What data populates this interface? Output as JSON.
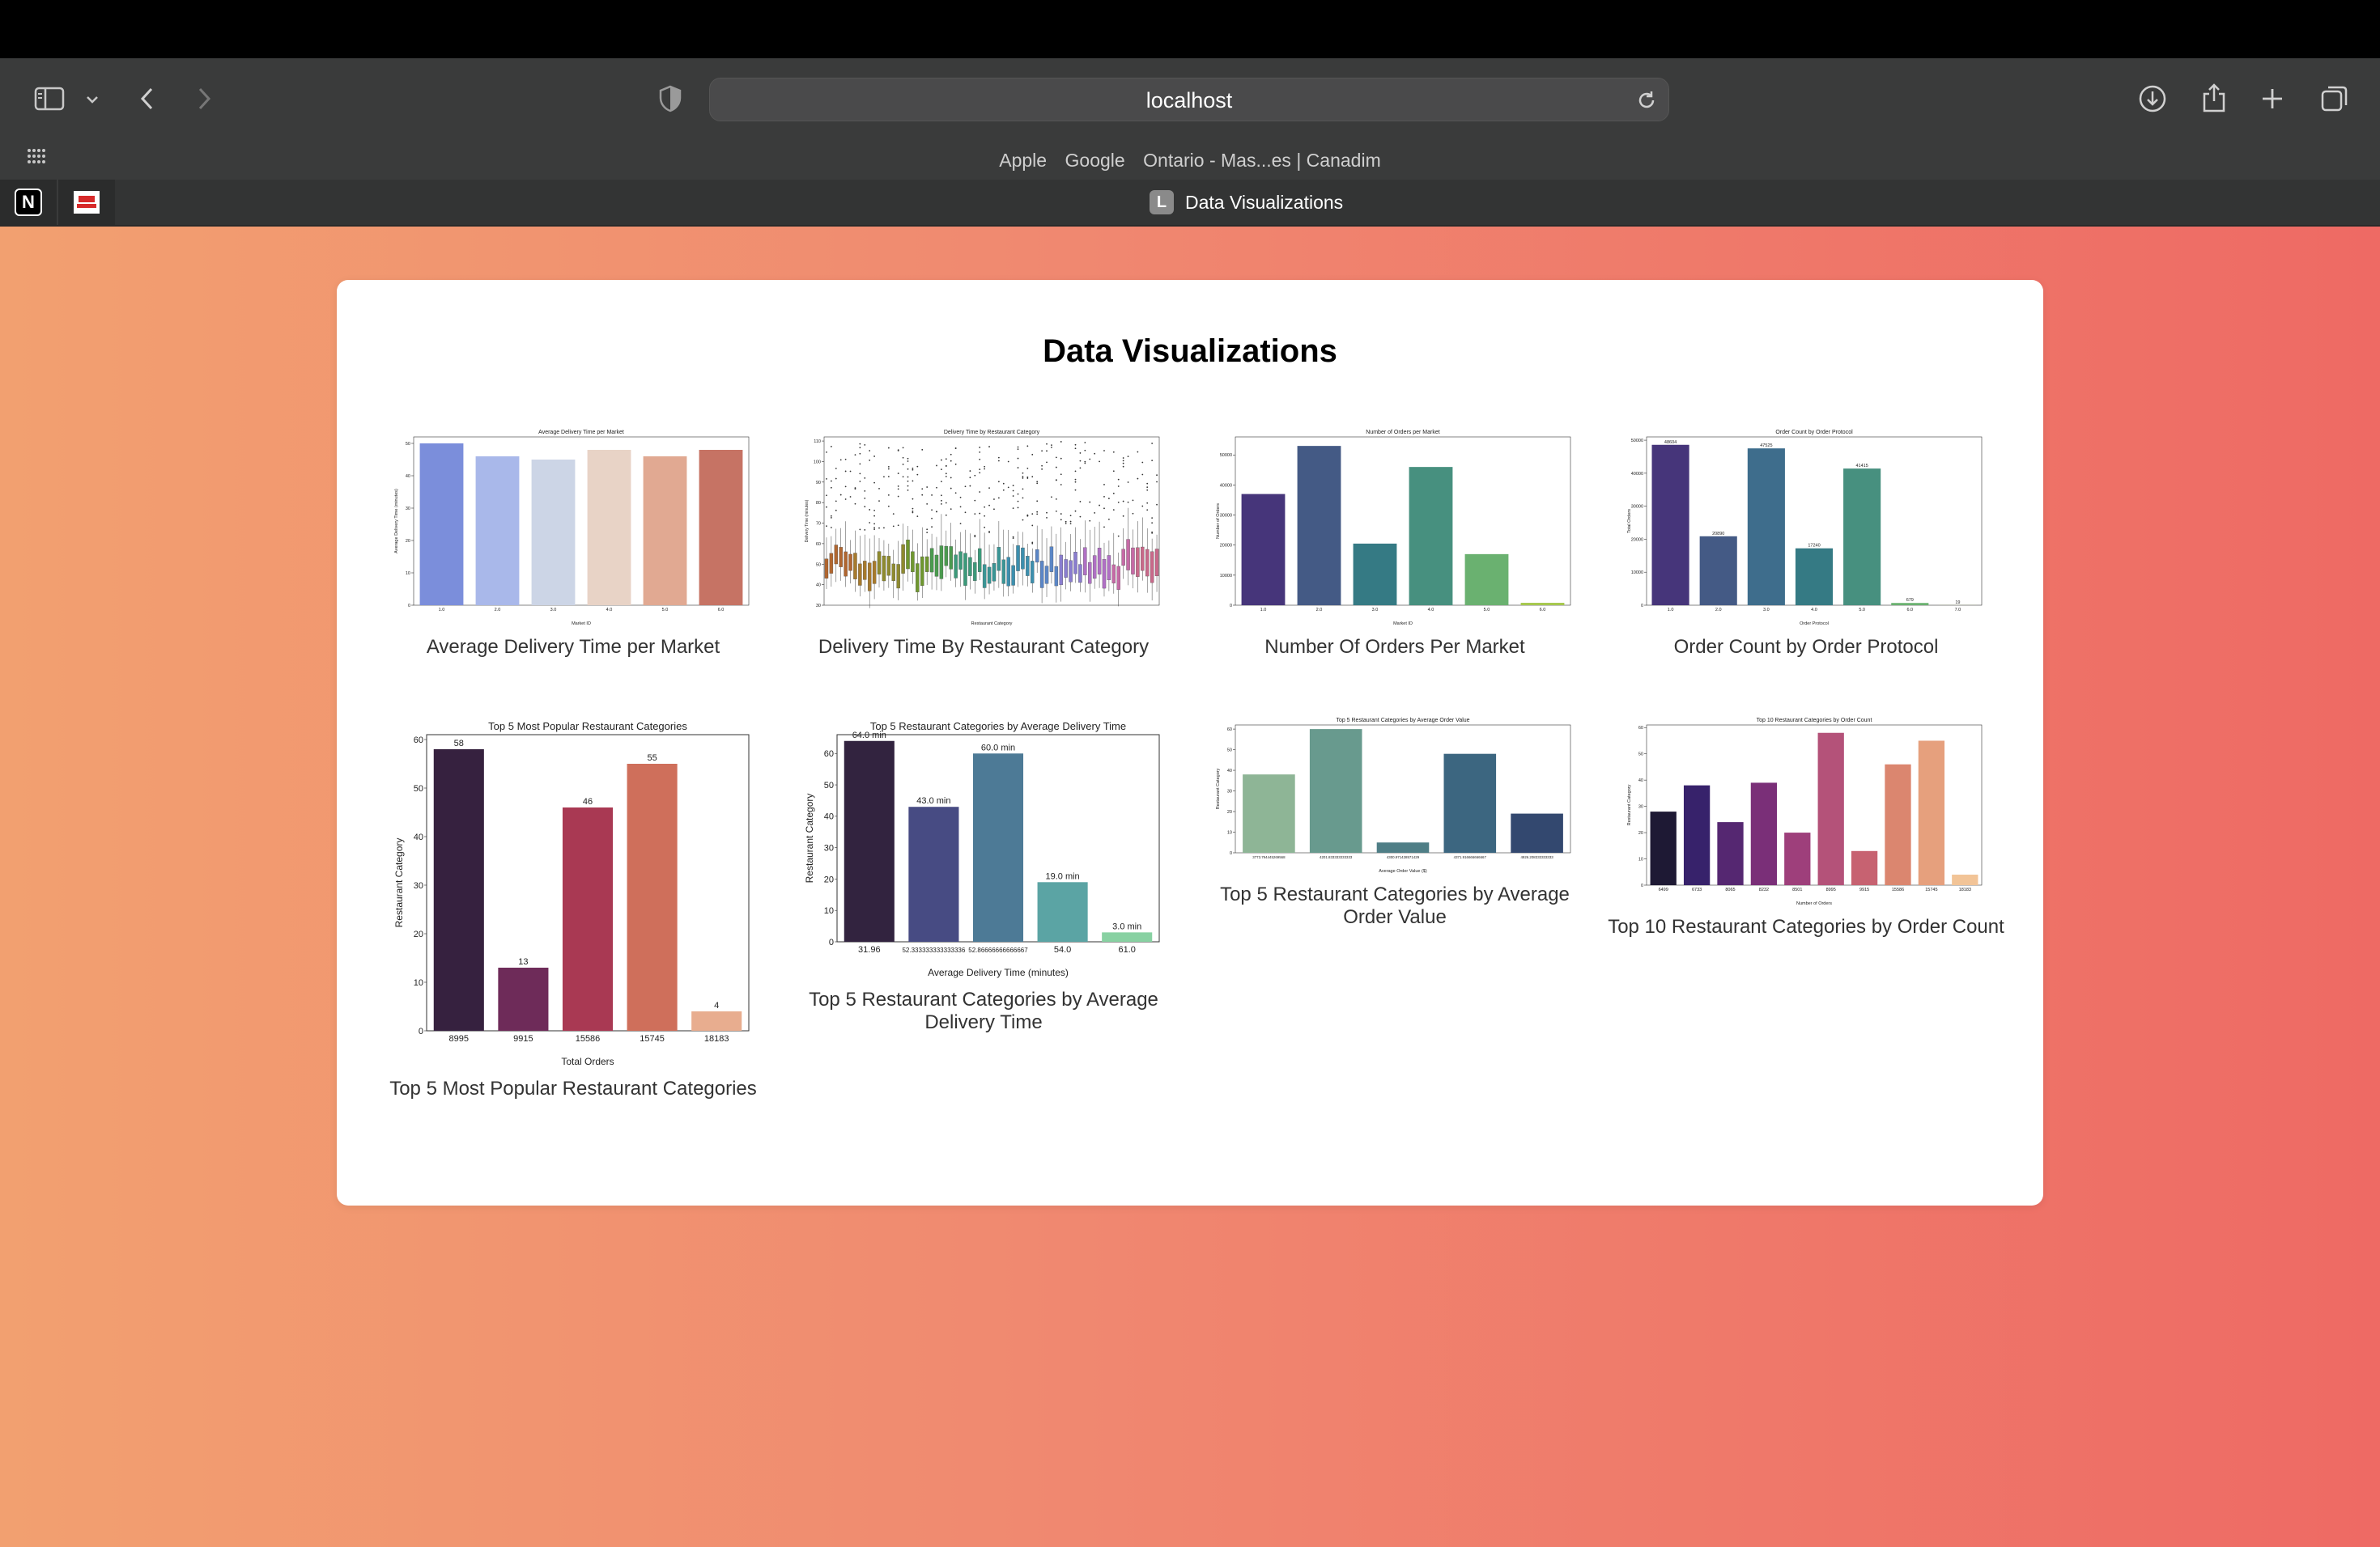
{
  "browser": {
    "url": "localhost",
    "bookmarks": [
      "Apple",
      "Google",
      "Ontario - Mas...es | Canadim"
    ],
    "tab": {
      "favicon_letter": "L",
      "title": "Data Visualizations"
    },
    "icons": [
      "sidebar-icon",
      "chevron-down-icon",
      "back-icon",
      "forward-icon",
      "shield-icon",
      "reload-icon",
      "download-icon",
      "share-icon",
      "plus-icon",
      "tabs-icon",
      "grid-icon",
      "notion-icon",
      "red-favicon-icon"
    ]
  },
  "page": {
    "title": "Data Visualizations"
  },
  "chart_data": [
    {
      "type": "bar",
      "title": "Average Delivery Time per Market",
      "caption": "Average Delivery Time per Market",
      "xlabel": "Market ID",
      "ylabel": "Average Delivery Time (minutes)",
      "categories": [
        "1.0",
        "2.0",
        "3.0",
        "4.0",
        "5.0",
        "6.0"
      ],
      "values": [
        50,
        46,
        45,
        48,
        46,
        48
      ],
      "ylim": [
        0,
        52
      ],
      "yticks": [
        0,
        10,
        20,
        30,
        40,
        50
      ],
      "colors": [
        "#7b8edb",
        "#a9b8ea",
        "#ccd5e6",
        "#e8d3c6",
        "#e1a992",
        "#c67364"
      ]
    },
    {
      "type": "box",
      "title": "Delivery Time by Restaurant Category",
      "caption": "Delivery Time By Restaurant Category",
      "xlabel": "Restaurant Category",
      "ylabel": "Delivery Time (minutes)",
      "ylim": [
        30,
        112
      ],
      "yticks": [
        30,
        40,
        50,
        60,
        70,
        80,
        90,
        100,
        110
      ]
    },
    {
      "type": "bar",
      "title": "Number of Orders per Market",
      "caption": "Number Of Orders Per Market",
      "xlabel": "Market ID",
      "ylabel": "Number of Orders",
      "categories": [
        "1.0",
        "2.0",
        "3.0",
        "4.0",
        "5.0",
        "6.0"
      ],
      "values": [
        37000,
        53000,
        20500,
        46000,
        17000,
        800
      ],
      "ylim": [
        0,
        56000
      ],
      "yticks": [
        0,
        10000,
        20000,
        30000,
        40000,
        50000
      ],
      "colors": [
        "#46357a",
        "#445a85",
        "#357a84",
        "#47907f",
        "#6ab170",
        "#a6c84e"
      ]
    },
    {
      "type": "bar",
      "title": "Order Count by Order Protocol",
      "caption": "Order Count by Order Protocol",
      "xlabel": "Order Protocol",
      "ylabel": "Total Orders",
      "categories": [
        "1.0",
        "2.0",
        "3.0",
        "4.0",
        "5.0",
        "6.0",
        "7.0"
      ],
      "values": [
        48604,
        20890,
        47525,
        17240,
        41415,
        679,
        19
      ],
      "labels": [
        "48604",
        "20890",
        "47525",
        "17240",
        "41415",
        "679",
        "19"
      ],
      "ylim": [
        0,
        51000
      ],
      "yticks": [
        0,
        10000,
        20000,
        30000,
        40000,
        50000
      ],
      "colors": [
        "#46357a",
        "#445a85",
        "#3e6d8c",
        "#357a84",
        "#47907f",
        "#6ab170",
        "#a6c84e"
      ]
    },
    {
      "type": "bar",
      "title": "Top 5 Most Popular Restaurant Categories",
      "caption": "Top 5 Most Popular Restaurant Categories",
      "xlabel": "Total Orders",
      "ylabel": "Restaurant Category",
      "categories": [
        "8995",
        "9915",
        "15586",
        "15745",
        "18183"
      ],
      "values": [
        58,
        13,
        46,
        55,
        4
      ],
      "labels": [
        "58",
        "13",
        "46",
        "55",
        "4"
      ],
      "ylim": [
        0,
        61
      ],
      "yticks": [
        0,
        10,
        20,
        30,
        40,
        50,
        60
      ],
      "colors": [
        "#36213f",
        "#6e2b59",
        "#a93953",
        "#cf6f5b",
        "#e8ad8f"
      ]
    },
    {
      "type": "bar",
      "title": "Top 5 Restaurant Categories by Average Delivery Time",
      "caption": "Top 5 Restaurant Categories by Average Delivery Time",
      "xlabel": "Average Delivery Time (minutes)",
      "ylabel": "Restaurant Category",
      "categories": [
        "31.96",
        "52.333333333333336",
        "52.86666666666667",
        "54.0",
        "61.0"
      ],
      "values": [
        64,
        43,
        60,
        19,
        3
      ],
      "labels": [
        "64.0 min",
        "43.0 min",
        "60.0 min",
        "19.0 min",
        "3.0 min"
      ],
      "ylim": [
        0,
        66
      ],
      "yticks": [
        0,
        10,
        20,
        30,
        40,
        50,
        60
      ],
      "colors": [
        "#32233f",
        "#474b83",
        "#4d7a96",
        "#5ba4a4",
        "#88d1a2"
      ]
    },
    {
      "type": "bar",
      "title": "Top 5 Restaurant Categories by Average Order Value",
      "caption": "Top 5 Restaurant Categories by Average Order Value",
      "xlabel": "Average Order Value ($)",
      "ylabel": "Restaurant Category",
      "categories": [
        "3773.794445269568",
        "4201.833333333333",
        "4300.971428571429",
        "4371.916666666667",
        "4926.208333333333"
      ],
      "values": [
        38,
        60,
        5,
        48,
        19
      ],
      "ylim": [
        0,
        62
      ],
      "yticks": [
        0,
        10,
        20,
        30,
        40,
        50,
        60
      ],
      "colors": [
        "#8eb596",
        "#689a8e",
        "#4f7e86",
        "#3c6680",
        "#33486f"
      ]
    },
    {
      "type": "bar",
      "title": "Top 10 Restaurant Categories by Order Count",
      "caption": "Top 10 Restaurant Categories by Order Count",
      "xlabel": "Number of Orders",
      "ylabel": "Restaurant Category",
      "categories": [
        "6499",
        "6733",
        "8065",
        "8232",
        "8501",
        "8995",
        "9915",
        "15586",
        "15745",
        "18183"
      ],
      "values": [
        28,
        38,
        24,
        39,
        20,
        58,
        13,
        46,
        55,
        4
      ],
      "ylim": [
        0,
        61
      ],
      "yticks": [
        0,
        10,
        20,
        30,
        40,
        50,
        60
      ],
      "colors": [
        "#1e1934",
        "#37226b",
        "#552771",
        "#7a2f78",
        "#9e3f7b",
        "#b45279",
        "#c76271",
        "#db866f",
        "#e6a07d",
        "#f2c497"
      ]
    }
  ]
}
